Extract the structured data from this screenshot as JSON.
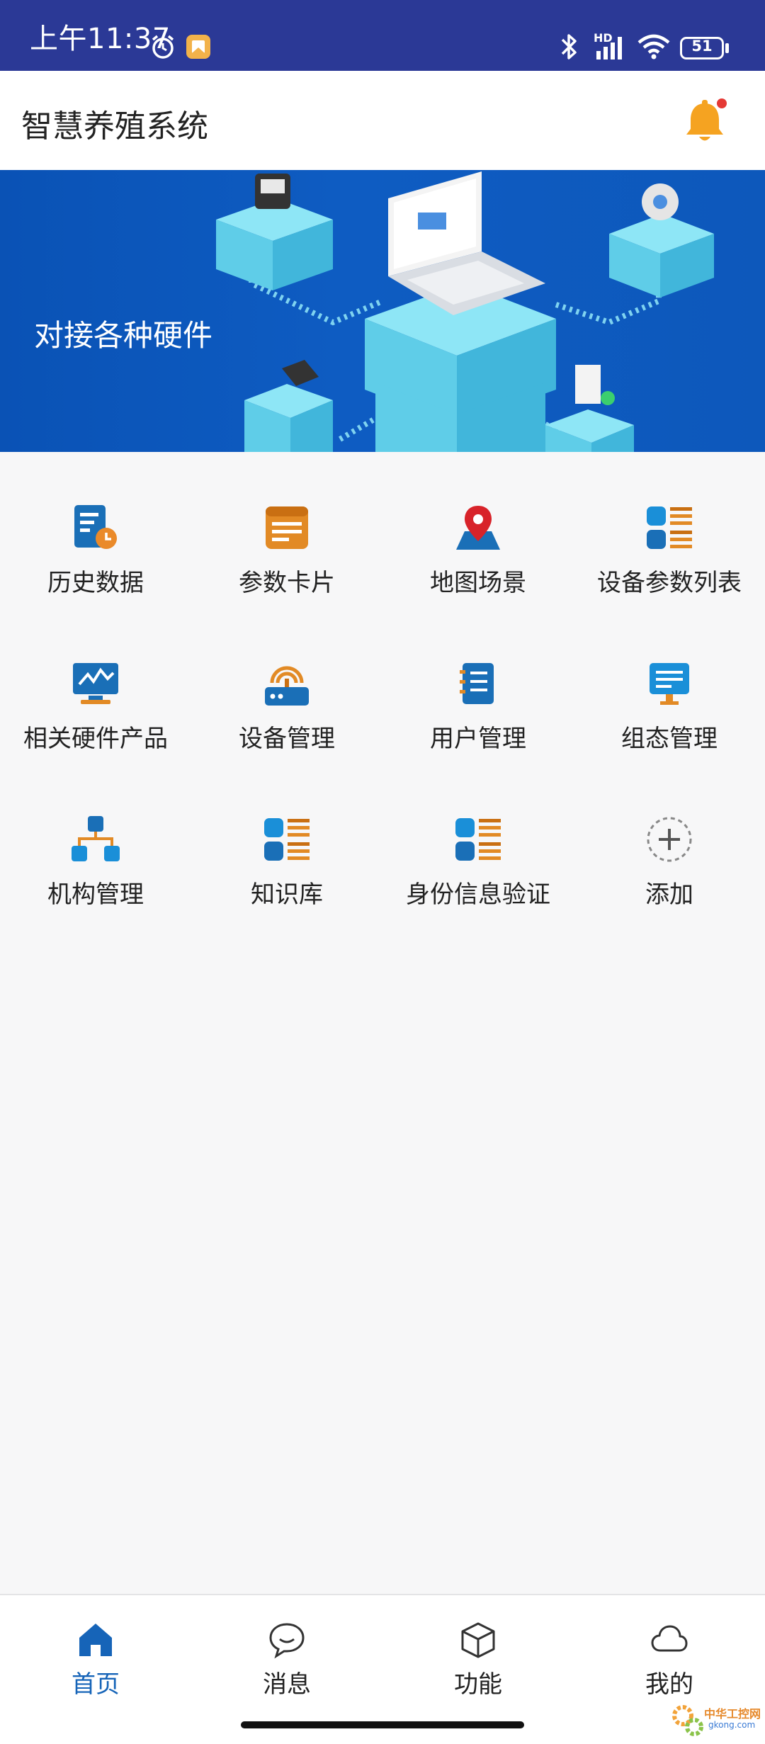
{
  "status_bar": {
    "time": "上午11:37",
    "hd_label": "HD",
    "battery": "51"
  },
  "header": {
    "title": "智慧养殖系统"
  },
  "banner": {
    "text": "对接各种硬件"
  },
  "grid": {
    "items": [
      {
        "label": "历史数据",
        "icon": "history-data-icon"
      },
      {
        "label": "参数卡片",
        "icon": "param-card-icon"
      },
      {
        "label": "地图场景",
        "icon": "map-pin-icon"
      },
      {
        "label": "设备参数列表",
        "icon": "list-icon"
      },
      {
        "label": "相关硬件产品",
        "icon": "monitor-chart-icon"
      },
      {
        "label": "设备管理",
        "icon": "router-icon"
      },
      {
        "label": "用户管理",
        "icon": "user-book-icon"
      },
      {
        "label": "组态管理",
        "icon": "screen-icon"
      },
      {
        "label": "机构管理",
        "icon": "org-chart-icon"
      },
      {
        "label": "知识库",
        "icon": "list-icon"
      },
      {
        "label": "身份信息验证",
        "icon": "list-icon"
      },
      {
        "label": "添加",
        "icon": "add-icon"
      }
    ]
  },
  "bottom_nav": {
    "items": [
      {
        "label": "首页",
        "icon": "home-icon",
        "active": true
      },
      {
        "label": "消息",
        "icon": "message-icon",
        "active": false
      },
      {
        "label": "功能",
        "icon": "cube-icon",
        "active": false
      },
      {
        "label": "我的",
        "icon": "cloud-icon",
        "active": false
      }
    ]
  },
  "watermark": {
    "text": "中华工控网",
    "sub": "gkong.com"
  },
  "colors": {
    "status_bar": "#2b3996",
    "banner": "#0e5cc2",
    "accent": "#1664b8",
    "orange": "#e8902a",
    "bell": "#f5a321",
    "dot": "#e53935"
  }
}
